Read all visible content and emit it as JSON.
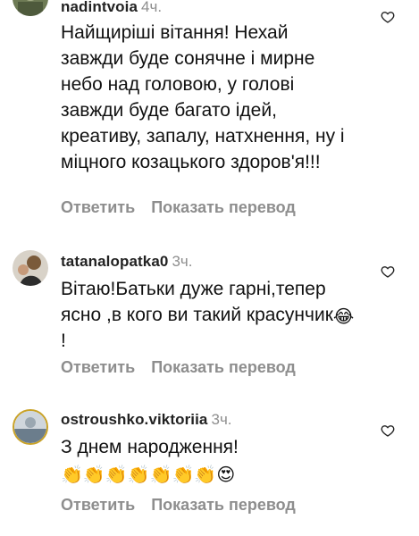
{
  "comments": [
    {
      "username": "nadintvoia",
      "time": "4ч.",
      "text": "Найщиріші вітання! Нехай завжди буде сонячне і мирне небо над головою, у голові завжди буде багато ідей, креативу, запалу, натхнення, ну і міцного козацького здоров'я!!!",
      "reply_label": "Ответить",
      "translate_label": "Показать перевод"
    },
    {
      "username": "tatanalopatka0",
      "time": "3ч.",
      "text": "Вітаю!Батьки дуже гарні,тепер ясно ,в кого ви такий красунчик",
      "emoji_tail": "😂",
      "text_tail": "!",
      "reply_label": "Ответить",
      "translate_label": "Показать перевод"
    },
    {
      "username": "ostroushko.viktoriia",
      "time": "3ч.",
      "text": "З днем народження!",
      "emoji_tail": "👏👏👏👏👏👏👏😍",
      "reply_label": "Ответить",
      "translate_label": "Показать перевод"
    }
  ],
  "icons": {
    "like": "heart-outline-icon",
    "avatar": "avatar-icon"
  },
  "colors": {
    "secondary_text": "#8e8e8e",
    "primary_text": "#111111"
  }
}
